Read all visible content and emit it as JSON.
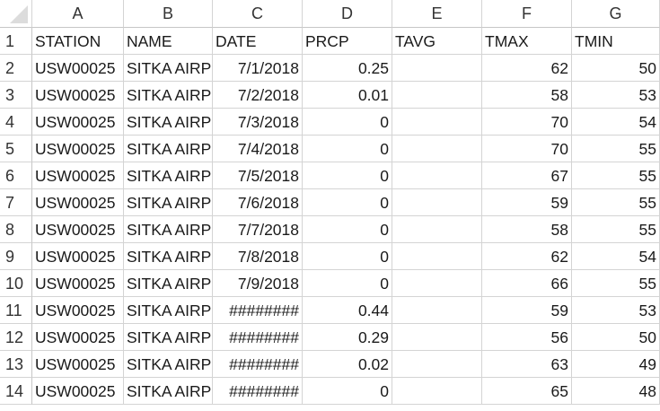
{
  "columns": [
    "A",
    "B",
    "C",
    "D",
    "E",
    "F",
    "G"
  ],
  "row_numbers": [
    "1",
    "2",
    "3",
    "4",
    "5",
    "6",
    "7",
    "8",
    "9",
    "10",
    "11",
    "12",
    "13",
    "14"
  ],
  "rows": [
    [
      "STATION",
      "NAME",
      "DATE",
      "PRCP",
      "TAVG",
      "TMAX",
      "TMIN"
    ],
    [
      "USW00025",
      "SITKA AIRP",
      "7/1/2018",
      "0.25",
      "",
      "62",
      "50"
    ],
    [
      "USW00025",
      "SITKA AIRP",
      "7/2/2018",
      "0.01",
      "",
      "58",
      "53"
    ],
    [
      "USW00025",
      "SITKA AIRP",
      "7/3/2018",
      "0",
      "",
      "70",
      "54"
    ],
    [
      "USW00025",
      "SITKA AIRP",
      "7/4/2018",
      "0",
      "",
      "70",
      "55"
    ],
    [
      "USW00025",
      "SITKA AIRP",
      "7/5/2018",
      "0",
      "",
      "67",
      "55"
    ],
    [
      "USW00025",
      "SITKA AIRP",
      "7/6/2018",
      "0",
      "",
      "59",
      "55"
    ],
    [
      "USW00025",
      "SITKA AIRP",
      "7/7/2018",
      "0",
      "",
      "58",
      "55"
    ],
    [
      "USW00025",
      "SITKA AIRP",
      "7/8/2018",
      "0",
      "",
      "62",
      "54"
    ],
    [
      "USW00025",
      "SITKA AIRP",
      "7/9/2018",
      "0",
      "",
      "66",
      "55"
    ],
    [
      "USW00025",
      "SITKA AIRP",
      "########",
      "0.44",
      "",
      "59",
      "53"
    ],
    [
      "USW00025",
      "SITKA AIRP",
      "########",
      "0.29",
      "",
      "56",
      "50"
    ],
    [
      "USW00025",
      "SITKA AIRP",
      "########",
      "0.02",
      "",
      "63",
      "49"
    ],
    [
      "USW00025",
      "SITKA AIRP",
      "########",
      "0",
      "",
      "65",
      "48"
    ]
  ]
}
